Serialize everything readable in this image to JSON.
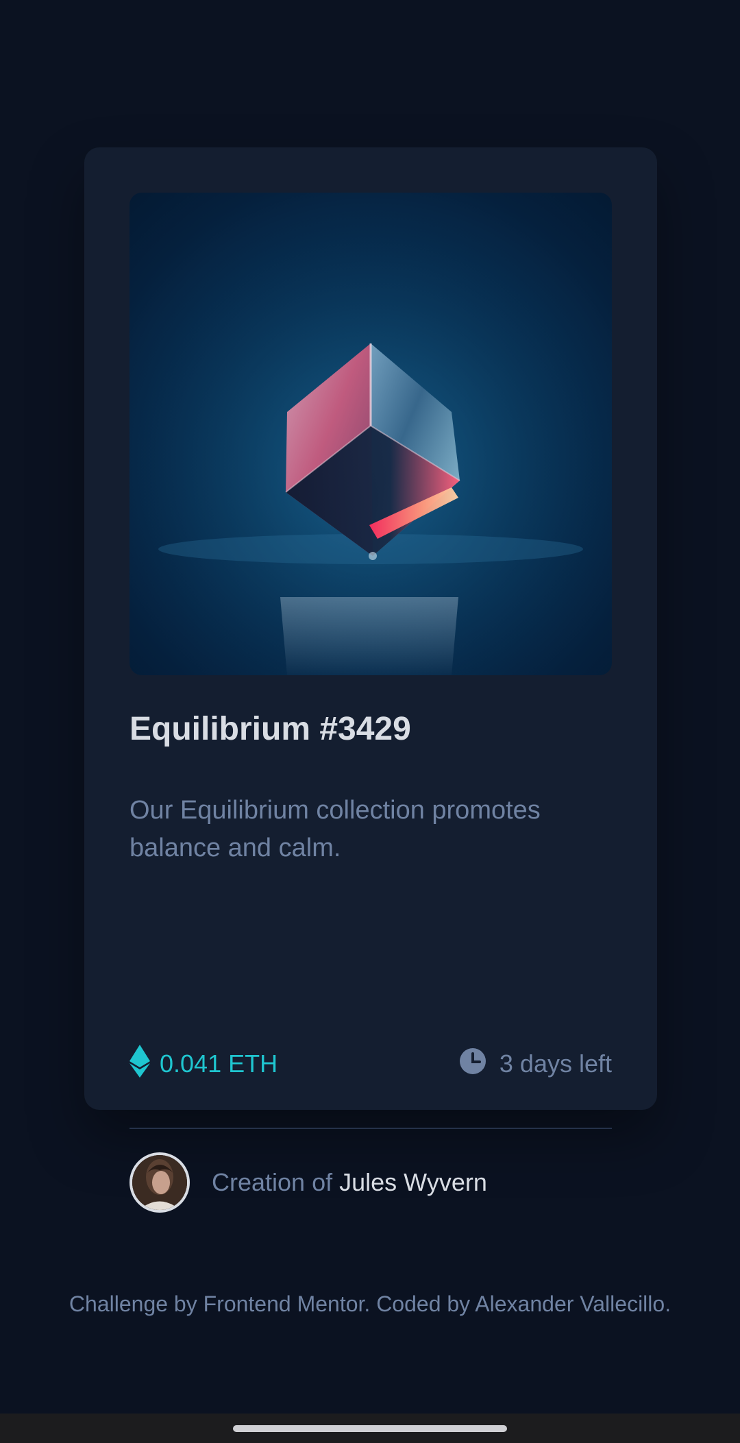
{
  "card": {
    "title": "Equilibrium #3429",
    "description": "Our Equilibrium collection promotes balance and calm.",
    "price": "0.041 ETH",
    "time_left": "3 days left",
    "creator_prefix": "Creation of",
    "creator_name": "Jules Wyvern"
  },
  "icons": {
    "price": "ethereum-icon",
    "time": "clock-icon",
    "image": "equilibrium-cube-image",
    "avatar": "creator-avatar"
  },
  "footer": {
    "attribution": "Challenge by Frontend Mentor. Coded by Alexander Vallecillo."
  },
  "colors": {
    "page_background": "#0b1221",
    "card_background": "#141e30",
    "accent_cyan": "#1fc6d0",
    "muted_text": "#7083a3",
    "white_text": "#d9dde4",
    "divider": "#25314a"
  }
}
